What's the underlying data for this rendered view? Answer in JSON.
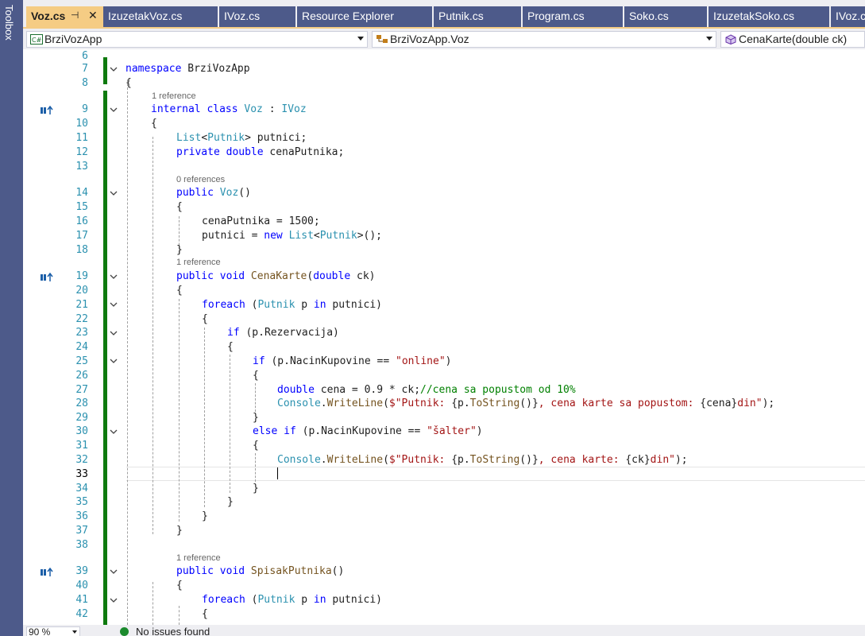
{
  "toolbox": {
    "label": "Toolbox"
  },
  "tabs": [
    {
      "label": "Voz.cs",
      "active": true
    },
    {
      "label": "IzuzetakVoz.cs"
    },
    {
      "label": "IVoz.cs"
    },
    {
      "label": "Resource Explorer"
    },
    {
      "label": "Putnik.cs"
    },
    {
      "label": "Program.cs"
    },
    {
      "label": "Soko.cs"
    },
    {
      "label": "IzuzetakSoko.cs"
    },
    {
      "label": "IVoz.cs"
    }
  ],
  "nav": {
    "project": "BrziVozApp",
    "type": "BrziVozApp.Voz",
    "member": "CenaKarte(double ck)"
  },
  "status": {
    "zoom": "90 %",
    "issues": "No issues found"
  },
  "codelens": {
    "one_ref": "1 reference",
    "zero_ref": "0 references"
  },
  "lines": {
    "l7_kw": "namespace",
    "l7_name": " BrziVozApp",
    "l9_kw": "internal class",
    "l9_type": "Voz",
    "l9_sep": " : ",
    "l9_iface": "IVoz",
    "l11_t1": "List",
    "l11_p1": "<",
    "l11_t2": "Putnik",
    "l11_p2": "> putnici;",
    "l12_kw": "private double",
    "l12_rest": " cenaPutnika;",
    "l14_kw": "public",
    "l14_ty": "Voz",
    "l14_rest": "()",
    "l16": "cenaPutnika = 1500;",
    "l17_a": "putnici = ",
    "l17_kw": "new",
    "l17_t1": "List",
    "l17_p": "<",
    "l17_t2": "Putnik",
    "l17_e": ">();",
    "l19_kw": "public void",
    "l19_me": "CenaKarte",
    "l19_p": "(",
    "l19_kw2": "double",
    "l19_e": " ck)",
    "l21_kw": "foreach",
    "l21_p": " (",
    "l21_ty": "Putnik",
    "l21_v": " p ",
    "l21_kw2": "in",
    "l21_e": " putnici)",
    "l23_kw": "if",
    "l23_e": " (p.Rezervacija)",
    "l25_kw": "if",
    "l25_a": " (p.NacinKupovine == ",
    "l25_st": "\"online\"",
    "l25_e": ")",
    "l27_kw": "double",
    "l27_a": " cena = 0.9 * ck;",
    "l27_cm": "//cena sa popustom od 10%",
    "l28_ty": "Console",
    "l28_d": ".",
    "l28_me": "WriteLine",
    "l28_p": "(",
    "l28_s1": "$\"Putnik: ",
    "l28_b1": "{",
    "l28_v1": "p.",
    "l28_me2": "ToString",
    "l28_c1": "()}",
    "l28_s2": ", cena karte sa popustom: ",
    "l28_b2": "{cena}",
    "l28_s3": "din\"",
    "l28_e": ");",
    "l30_kw": "else if",
    "l30_a": " (p.NacinKupovine == ",
    "l30_st": "\"šalter\"",
    "l30_e": ")",
    "l32_ty": "Console",
    "l32_d": ".",
    "l32_me": "WriteLine",
    "l32_p": "(",
    "l32_s1": "$\"Putnik: ",
    "l32_b1": "{",
    "l32_v1": "p.",
    "l32_me2": "ToString",
    "l32_c1": "()}",
    "l32_s2": ", cena karte: ",
    "l32_b2": "{ck}",
    "l32_s3": "din\"",
    "l32_e": ");",
    "l39_kw": "public void",
    "l39_me": "SpisakPutnika",
    "l39_e": "()",
    "l41_kw": "foreach",
    "l41_p": " (",
    "l41_ty": "Putnik",
    "l41_v": " p ",
    "l41_kw2": "in",
    "l41_e": " putnici)",
    "brace_open": "{",
    "brace_close": "}"
  },
  "line_numbers": [
    "6",
    "7",
    "8",
    "9",
    "10",
    "11",
    "12",
    "13",
    "14",
    "15",
    "16",
    "17",
    "18",
    "19",
    "20",
    "21",
    "22",
    "23",
    "24",
    "25",
    "26",
    "27",
    "28",
    "29",
    "30",
    "31",
    "32",
    "33",
    "34",
    "35",
    "36",
    "37",
    "38",
    "39",
    "40",
    "41",
    "42"
  ],
  "colors": {
    "keyword": "#0000ff",
    "type": "#2b91af",
    "method": "#74531f",
    "string": "#a31515",
    "comment": "#008000",
    "tab_active": "#f5cc84",
    "tab_inactive": "#4d5a8a",
    "change_margin": "#0e7a0e"
  }
}
